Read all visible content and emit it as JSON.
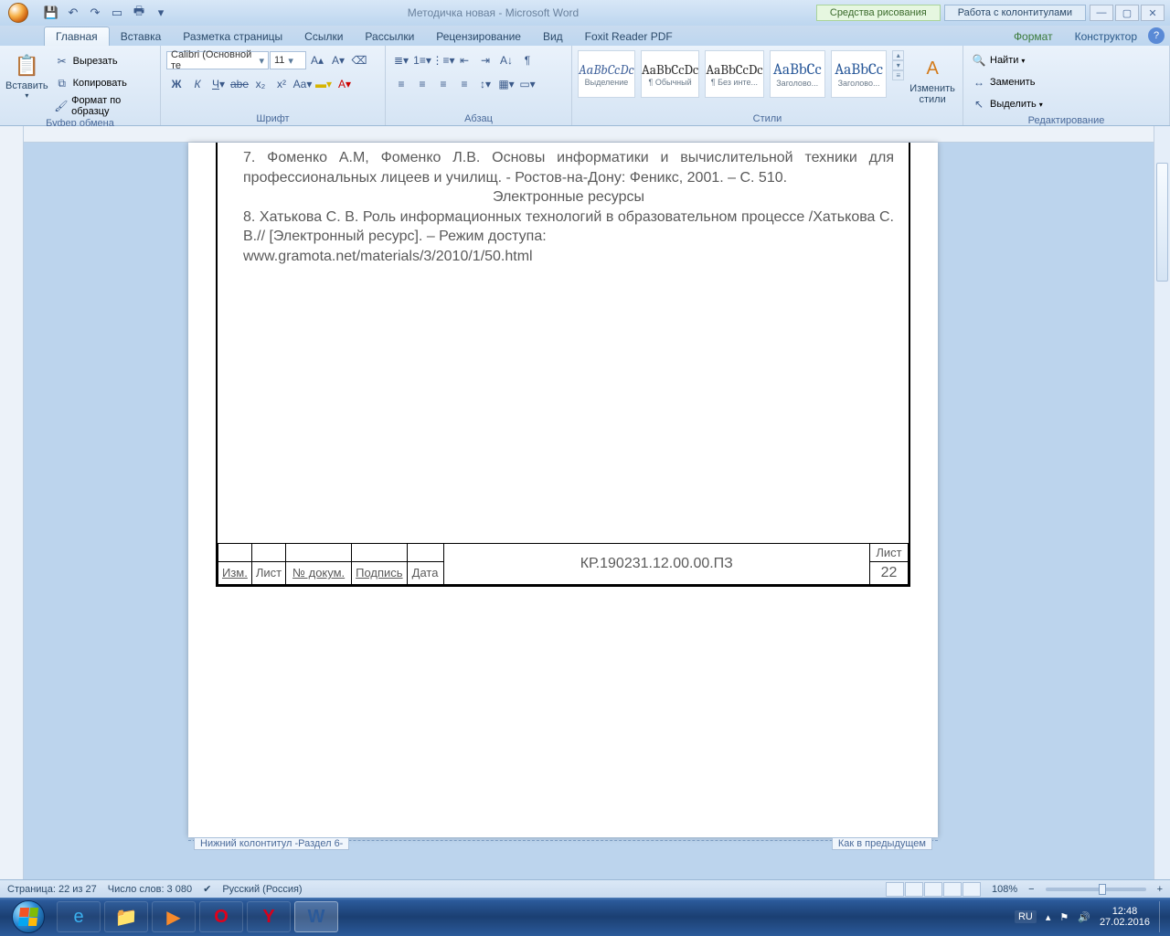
{
  "title": "Методичка новая - Microsoft Word",
  "context_tabs": {
    "drawing": "Средства рисования",
    "headerfooter": "Работа с колонтитулами"
  },
  "tabs": [
    "Главная",
    "Вставка",
    "Разметка страницы",
    "Ссылки",
    "Рассылки",
    "Рецензирование",
    "Вид",
    "Foxit Reader PDF"
  ],
  "context_sub": [
    "Формат",
    "Конструктор"
  ],
  "ribbon": {
    "clipboard": {
      "title": "Буфер обмена",
      "paste": "Вставить",
      "cut": "Вырезать",
      "copy": "Копировать",
      "format": "Формат по образцу"
    },
    "font": {
      "title": "Шрифт",
      "name": "Calibri (Основной те",
      "size": "11"
    },
    "paragraph": {
      "title": "Абзац"
    },
    "styles": {
      "title": "Стили",
      "change": "Изменить\nстили",
      "items": [
        {
          "preview": "AaBbCcDc",
          "name": "Выделение"
        },
        {
          "preview": "AaBbCcDc",
          "name": "¶ Обычный"
        },
        {
          "preview": "AaBbCcDc",
          "name": "¶ Без инте..."
        },
        {
          "preview": "AaBbCc",
          "name": "Заголово..."
        },
        {
          "preview": "AaBbCc",
          "name": "Заголово..."
        }
      ]
    },
    "editing": {
      "title": "Редактирование",
      "find": "Найти",
      "replace": "Заменить",
      "select": "Выделить"
    }
  },
  "document": {
    "p1": "7.   Фоменко А.М, Фоменко Л.В.   Основы информатики и вычислительной техники для профессиональных лицеев и училищ. - Ростов-на-Дону: Феникс, 2001. – С. 510.",
    "h_resources": "Электронные ресурсы",
    "p2": "8.  Хатькова С. В.  Роль  информационных  технологий  в  образовательном процессе /Хатькова С. В.// [Электронный ресурс]. – Режим доступа: ",
    "p3": "www.gramota.net/materials/3/2010/1/50.html",
    "stamp": {
      "code": "КР.190231.12.00.00.ПЗ",
      "sheet_label": "Лист",
      "sheet_num": "22",
      "cols": [
        "Изм.",
        "Лист",
        "№ докум.",
        "Подпись",
        "Дата"
      ]
    },
    "footer_label": "Нижний колонтитул -Раздел 6-",
    "same_as_prev": "Как в предыдущем"
  },
  "status": {
    "page": "Страница: 22 из 27",
    "words": "Число слов: 3 080",
    "lang": "Русский (Россия)",
    "zoom": "108%"
  },
  "taskbar": {
    "lang": "RU",
    "time": "12:48",
    "date": "27.02.2016"
  }
}
